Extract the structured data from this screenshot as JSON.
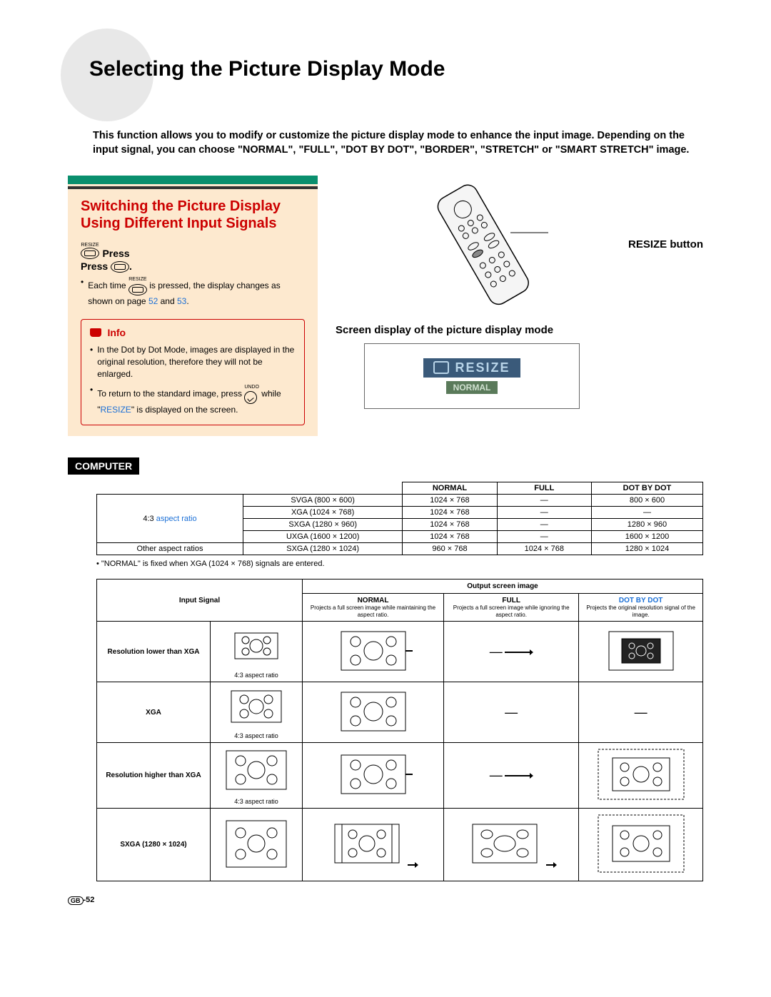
{
  "title": "Selecting the Picture Display Mode",
  "intro": "This function allows you to modify or customize the picture display mode to enhance the input image. Depending on the input signal, you can choose \"NORMAL\", \"FULL\", \"DOT BY DOT\", \"BORDER\", \"STRETCH\" or \"SMART STRETCH\" image.",
  "panel": {
    "heading": "Switching the Picture Display Using Different Input Signals",
    "resize_small": "RESIZE",
    "press": "Press ",
    "press_after": ".",
    "each_time_1": "Each time ",
    "each_time_2": " is pressed, the display changes as shown on page ",
    "page_a": "52",
    "and": " and ",
    "page_b": "53",
    "period": "."
  },
  "info": {
    "label": "Info",
    "b1": "In the Dot by Dot Mode, images are displayed in the original resolution, therefore they will not be enlarged.",
    "b2_a": "To return to the standard image, press ",
    "undo_small": "UNDO",
    "b2_b": " while \"",
    "resize_word": "RESIZE",
    "b2_c": "\" is displayed on the screen."
  },
  "right": {
    "remote_label": "RESIZE button",
    "screen_title": "Screen display of the picture display mode",
    "osd_resize": "RESIZE",
    "osd_normal": "NORMAL"
  },
  "computer_tag": "COMPUTER",
  "table1": {
    "h_normal": "NORMAL",
    "h_full": "FULL",
    "h_dot": "DOT BY DOT",
    "ratio43_label": "4:3 ",
    "ratio43_link": "aspect ratio",
    "other_label": "Other aspect ratios",
    "rows": [
      {
        "sig": "SVGA (800 × 600)",
        "n": "1024 × 768",
        "f": "—",
        "d": "800 × 600"
      },
      {
        "sig": "XGA (1024 × 768)",
        "n": "1024 × 768",
        "f": "—",
        "d": "—"
      },
      {
        "sig": "SXGA (1280 × 960)",
        "n": "1024 × 768",
        "f": "—",
        "d": "1280 × 960"
      },
      {
        "sig": "UXGA (1600 × 1200)",
        "n": "1024 × 768",
        "f": "—",
        "d": "1600 × 1200"
      },
      {
        "sig": "SXGA (1280 × 1024)",
        "n": "960 × 768",
        "f": "1024 × 768",
        "d": "1280 × 1024"
      }
    ]
  },
  "note": "• \"NORMAL\" is fixed when XGA (1024 × 768) signals are entered.",
  "table2": {
    "input_signal": "Input Signal",
    "output_header": "Output screen image",
    "h_normal": "NORMAL",
    "h_full": "FULL",
    "h_dot": "DOT BY DOT",
    "desc_normal": "Projects a full screen image while maintaining the aspect ratio.",
    "desc_full": "Projects a full screen image while ignoring the aspect ratio.",
    "desc_dot": "Projects the original resolution signal of the image.",
    "rows": [
      {
        "label": "Resolution lower than XGA",
        "ratio": "4:3 aspect ratio"
      },
      {
        "label": "XGA",
        "ratio": "4:3 aspect ratio"
      },
      {
        "label": "Resolution higher than XGA",
        "ratio": "4:3 aspect ratio"
      },
      {
        "label": "SXGA (1280 × 1024)",
        "ratio": ""
      }
    ]
  },
  "page_number": "-52",
  "gb": "GB"
}
